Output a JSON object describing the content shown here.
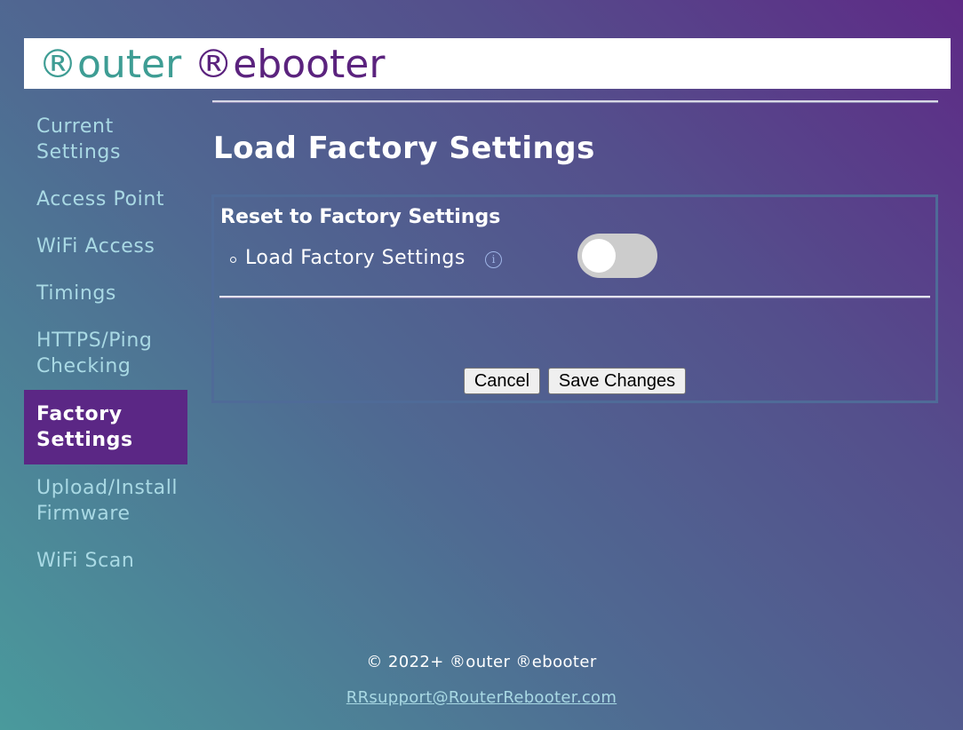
{
  "brand": {
    "logo_part1": "®outer",
    "logo_part2": "®ebooter",
    "colors": {
      "router": "#3e9d94",
      "rebooter": "#5b237e",
      "active_nav": "#5b2785"
    }
  },
  "sidebar": {
    "items": [
      {
        "label": "Current Settings",
        "active": false
      },
      {
        "label": "Access Point",
        "active": false
      },
      {
        "label": "WiFi Access",
        "active": false
      },
      {
        "label": "Timings",
        "active": false
      },
      {
        "label": "HTTPS/Ping Checking",
        "active": false
      },
      {
        "label": "Factory Settings",
        "active": true
      },
      {
        "label": "Upload/Install Firmware",
        "active": false
      },
      {
        "label": "WiFi Scan",
        "active": false
      }
    ]
  },
  "main": {
    "title": "Load Factory Settings",
    "section": {
      "title": "Reset to Factory Settings",
      "setting": {
        "label": "Load Factory Settings",
        "info_icon": "info-icon",
        "info_glyph": "i",
        "toggle_on": false
      }
    },
    "buttons": {
      "cancel": "Cancel",
      "save": "Save Changes"
    }
  },
  "footer": {
    "copyright": "© 2022+ ®outer ®ebooter",
    "email": "RRsupport@RouterRebooter.com"
  }
}
